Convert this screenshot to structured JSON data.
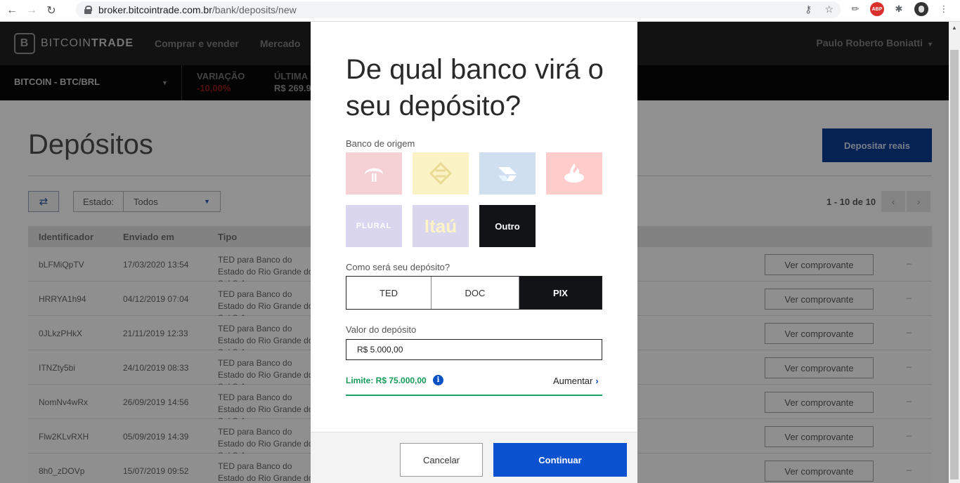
{
  "browser": {
    "url_host": "broker.bitcointrade.com.br",
    "url_path": "/bank/deposits/new",
    "extensions": [
      "key-icon",
      "star-icon",
      "eyedropper-icon",
      "abp-icon",
      "puzzle-icon",
      "avatar-icon",
      "more-icon"
    ],
    "abp_label": "ABP"
  },
  "header": {
    "logo_light": "BITCOIN",
    "logo_bold": "TRADE",
    "logo_mark": "B",
    "nav": [
      "Comprar e vender",
      "Mercado"
    ],
    "user_name": "Paulo Roberto Boniatti"
  },
  "market": {
    "pair": "BITCOIN - BTC/BRL",
    "variation_label": "VARIAÇÃO",
    "variation_value": "-10,00%",
    "last_label": "ÚLTIMA",
    "last_value": "R$ 269.9"
  },
  "page": {
    "title": "Depósitos",
    "deposit_button": "Depositar reais",
    "filter_label": "Estado:",
    "filter_value": "Todos",
    "pagination": "1 - 10 de 10",
    "columns": [
      "Identificador",
      "Enviado em",
      "Tipo"
    ],
    "rows": [
      {
        "id": "bLFMiQpTV",
        "date": "17/03/2020  13:54",
        "tipo": "TED para Banco do Estado do Rio Grande do Sul S.A.",
        "action": "Ver comprovante"
      },
      {
        "id": "HRRYA1h94",
        "date": "04/12/2019  07:04",
        "tipo": "TED para Banco do Estado do Rio Grande do Sul S.A.",
        "action": "Ver comprovante"
      },
      {
        "id": "0JLkzPHkX",
        "date": "21/11/2019  12:33",
        "tipo": "TED para Banco do Estado do Rio Grande do Sul S.A.",
        "action": "Ver comprovante"
      },
      {
        "id": "ITNZty5bi",
        "date": "24/10/2019  08:33",
        "tipo": "TED para Banco do Estado do Rio Grande do Sul S.A.",
        "action": "Ver comprovante"
      },
      {
        "id": "NomNv4wRx",
        "date": "26/09/2019  14:56",
        "tipo": "TED para Banco do Estado do Rio Grande do Sul S.A.",
        "action": "Ver comprovante"
      },
      {
        "id": "Flw2KLvRXH",
        "date": "05/09/2019  14:39",
        "tipo": "TED para Banco do Estado do Rio Grande do Sul S.A.",
        "action": "Ver comprovante"
      },
      {
        "id": "8h0_zDOVp",
        "date": "15/07/2019  09:52",
        "tipo": "TED para Banco do Estado do Rio Grande do Sul S.A.",
        "action": "Ver comprovante"
      }
    ],
    "dash": "–"
  },
  "modal": {
    "title": "De qual banco virá o seu depósito?",
    "origin_label": "Banco de origem",
    "banks": {
      "plural": "PLURAL",
      "itau": "Itaú",
      "outro": "Outro"
    },
    "method_label": "Como será seu depósito?",
    "methods": {
      "ted": "TED",
      "doc": "DOC",
      "pix": "PIX"
    },
    "selected_method": "PIX",
    "amount_label": "Valor do depósito",
    "amount_value": "R$ 5.000,00",
    "limit_text": "Limite: R$ 75.000,00",
    "increase_label": "Aumentar",
    "cancel_label": "Cancelar",
    "continue_label": "Continuar"
  },
  "colors": {
    "primary": "#0a52d0",
    "limit_green": "#169b5a",
    "variation_red": "#cc1f1f"
  }
}
